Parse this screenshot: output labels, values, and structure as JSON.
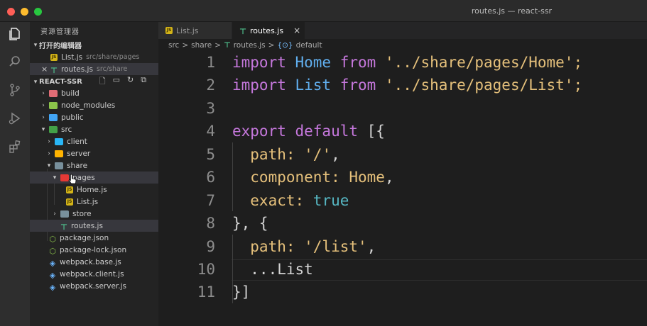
{
  "window": {
    "title": "routes.js — react-ssr"
  },
  "sidebar": {
    "header": "资源管理器",
    "open_editors": {
      "label": "打开的编辑器",
      "items": [
        {
          "name": "List.js",
          "path": "src/share/pages"
        },
        {
          "name": "routes.js",
          "path": "src/share",
          "close": "×"
        }
      ]
    },
    "project": {
      "label": "REACT-SSR",
      "tree": [
        {
          "label": "build"
        },
        {
          "label": "node_modules"
        },
        {
          "label": "public"
        },
        {
          "label": "src"
        },
        {
          "label": "client"
        },
        {
          "label": "server"
        },
        {
          "label": "share"
        },
        {
          "label": "pages"
        },
        {
          "label": "Home.js"
        },
        {
          "label": "List.js"
        },
        {
          "label": "store"
        },
        {
          "label": "routes.js"
        },
        {
          "label": "package.json"
        },
        {
          "label": "package-lock.json"
        },
        {
          "label": "webpack.base.js"
        },
        {
          "label": "webpack.client.js"
        },
        {
          "label": "webpack.server.js"
        }
      ]
    }
  },
  "tabs": [
    {
      "label": "List.js"
    },
    {
      "label": "routes.js",
      "close": "×"
    }
  ],
  "breadcrumb": {
    "parts": [
      "src",
      "share",
      "routes.js",
      "default"
    ],
    "sep": ">",
    "symbol": "{⊙}"
  },
  "editor": {
    "line_numbers": [
      "1",
      "2",
      "3",
      "4",
      "5",
      "6",
      "7",
      "8",
      "9",
      "10",
      "11"
    ],
    "lines": [
      [
        "import",
        " Home ",
        "from",
        " '../share/pages/Home';"
      ],
      [
        "import",
        " List ",
        "from",
        " '../share/pages/List';"
      ],
      [],
      [
        "export default",
        " [{"
      ],
      [
        "  path: ",
        "'/'",
        ","
      ],
      [
        "  component: ",
        "Home",
        ","
      ],
      [
        "  exact: ",
        "true"
      ],
      [
        "}, {"
      ],
      [
        "  path: ",
        "'/list'",
        ","
      ],
      [
        "  ...List"
      ],
      [
        "}]"
      ]
    ]
  },
  "colors": {
    "keyword": "#c678dd",
    "identifier": "#61afef",
    "string": "#e5c07b",
    "boolean": "#56b6c2",
    "plain": "#d4d4d4"
  },
  "icons": [
    "files-icon",
    "search-icon",
    "source-control-icon",
    "run-debug-icon",
    "extensions-icon"
  ]
}
